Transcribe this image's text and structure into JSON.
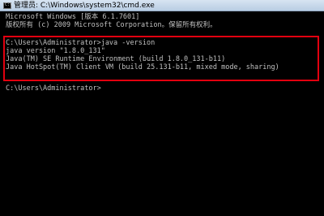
{
  "window": {
    "title": "管理员: C:\\Windows\\system32\\cmd.exe",
    "icon": "cmd-icon",
    "highlight_color": "#e2000f",
    "text_color": "#c0c0c0",
    "background_color": "#000000"
  },
  "console": {
    "lines": [
      "Microsoft Windows [版本 6.1.7601]",
      "版权所有 (c) 2009 Microsoft Corporation。保留所有权利。",
      "",
      "C:\\Users\\Administrator>java -version",
      "java version \"1.8.0_131\"",
      "Java(TM) SE Runtime Environment (build 1.8.0_131-b11)",
      "Java HotSpot(TM) Client VM (build 25.131-b11, mixed mode, sharing)",
      "",
      "C:\\Users\\Administrator>"
    ]
  }
}
